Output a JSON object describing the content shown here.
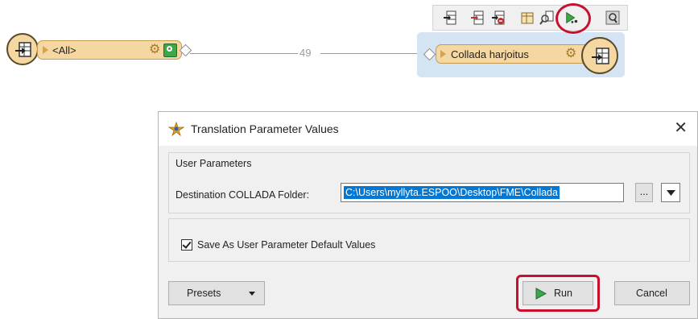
{
  "canvas": {
    "source_node": {
      "label": "<All>"
    },
    "connection": {
      "feature_count": "49"
    },
    "writer_node": {
      "label": "Collada harjoitus"
    },
    "toolbar": {
      "buttons": [
        "add-reader-icon",
        "add-writer-icon",
        "remove-icon",
        "table-icon",
        "inspect-icon",
        "run-to-this-icon",
        "view-source-icon"
      ]
    }
  },
  "dialog": {
    "title": "Translation Parameter Values",
    "close_label": "✕",
    "group_label": "User Parameters",
    "param_label": "Destination COLLADA Folder:",
    "param_value": "C:\\Users\\myllyta.ESPOO\\Desktop\\FME\\Collada",
    "browse_label": "...",
    "save_default_label": "Save As User Parameter Default Values",
    "save_default_checked": true,
    "presets_label": "Presets",
    "run_label": "Run",
    "cancel_label": "Cancel"
  },
  "colors": {
    "node_fill": "#f5d7a1",
    "highlight": "#c8102e",
    "selection": "#0078d7",
    "run_green": "#3fa64a"
  }
}
